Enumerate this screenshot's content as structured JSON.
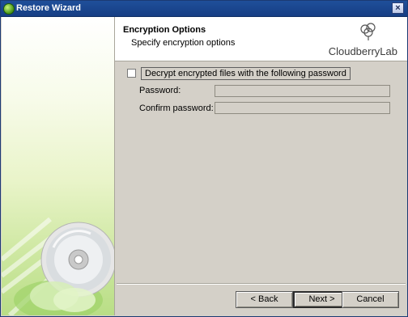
{
  "window": {
    "title": "Restore Wizard",
    "close_glyph": "×",
    "title_icon": "cloudberry-app-icon"
  },
  "header": {
    "title": "Encryption Options",
    "subtitle": "Specify encryption options",
    "brand": "CloudberryLab"
  },
  "form": {
    "decrypt_checkbox": {
      "label": "Decrypt encrypted files with the following password",
      "checked": false
    },
    "password_label": "Password:",
    "password_value": "",
    "confirm_label": "Confirm password:",
    "confirm_value": ""
  },
  "buttons": {
    "back": "< Back",
    "next": "Next >",
    "cancel": "Cancel"
  },
  "colors": {
    "titlebar": "#1f4f9a",
    "dialog_bg": "#d4d0c8",
    "side_panel_green": "#b9de86"
  }
}
